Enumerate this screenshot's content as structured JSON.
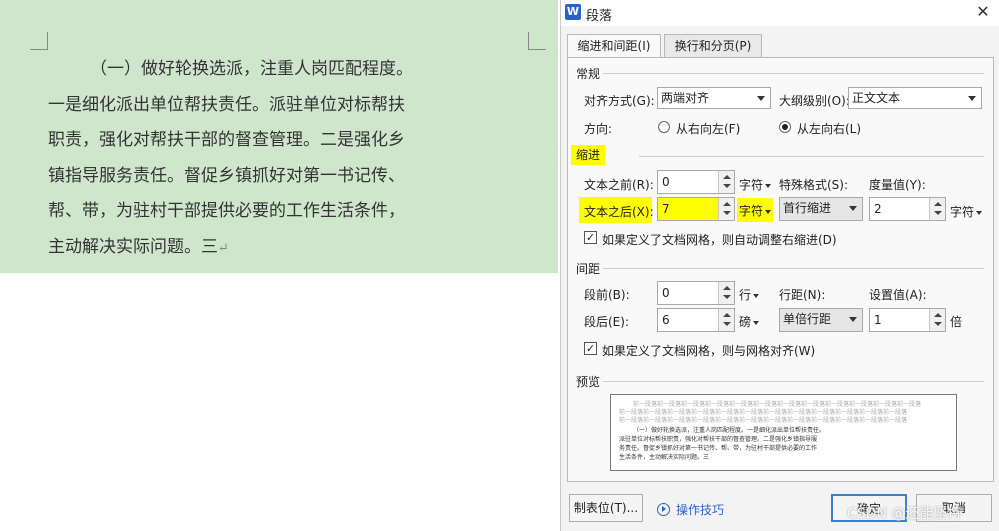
{
  "document": {
    "paragraph_lines": [
      "（一）做好轮换选派，注重人岗匹配程度。",
      "一是细化派出单位帮扶责任。派驻单位对标帮扶",
      "职责，强化对帮扶干部的督查管理。二是强化乡",
      "镇指导服务责任。督促乡镇抓好对第一书记传、",
      "帮、带，为驻村干部提供必要的工作生活条件，",
      "主动解决实际问题。三"
    ],
    "paragraph_mark": "↵"
  },
  "dialog": {
    "app_icon": "W",
    "title": "段落",
    "close_glyph": "✕",
    "tabs": [
      {
        "label": "缩进和间距(I)",
        "active": true
      },
      {
        "label": "换行和分页(P)",
        "active": false
      }
    ],
    "general": {
      "heading": "常规",
      "alignment_label": "对齐方式(G):",
      "alignment_value": "两端对齐",
      "outline_label": "大纲级别(O):",
      "outline_value": "正文文本",
      "direction_label": "方向:",
      "rtl_label": "从右向左(F)",
      "ltr_label": "从左向右(L)",
      "direction_selected": "ltr"
    },
    "indent": {
      "heading": "缩进",
      "before_label": "文本之前(R):",
      "before_value": "0",
      "before_unit": "字符",
      "after_label": "文本之后(X):",
      "after_value": "7",
      "after_unit": "字符",
      "special_label": "特殊格式(S):",
      "special_value": "首行缩进",
      "measure_label": "度量值(Y):",
      "measure_value": "2",
      "measure_unit": "字符",
      "grid_check_label": "如果定义了文档网格，则自动调整右缩进(D)",
      "grid_checked": true
    },
    "spacing": {
      "heading": "间距",
      "before_label": "段前(B):",
      "before_value": "0",
      "before_unit": "行",
      "after_label": "段后(E):",
      "after_value": "6",
      "after_unit": "磅",
      "line_label": "行距(N):",
      "line_value": "单倍行距",
      "set_label": "设置值(A):",
      "set_value": "1",
      "set_unit": "倍",
      "grid_check_label": "如果定义了文档网格，则与网格对齐(W)",
      "grid_checked": true
    },
    "preview": {
      "heading": "预览",
      "prev_text": "前一段落前一段落前一段落前一段落前一段落前一段落前一段落前一段落前一段落前一段落前一段落前一段落",
      "body_lines": [
        "（一）做好轮换选派，注重人岗匹配程度。一是细化派出单位帮扶责任。",
        "派驻单位对标帮扶职责，强化对帮扶干部的督查管理。二是强化乡镇指导服",
        "务责任。督促乡镇抓好对第一书记传、帮、带，为驻村干部提供必要的工作",
        "生活条件，主动解决实际问题。三"
      ]
    },
    "buttons": {
      "tabs_button": "制表位(T)...",
      "tips_link": "操作技巧",
      "ok": "确定",
      "cancel": "取消"
    },
    "watermark": "CSDN @还能坚持"
  }
}
